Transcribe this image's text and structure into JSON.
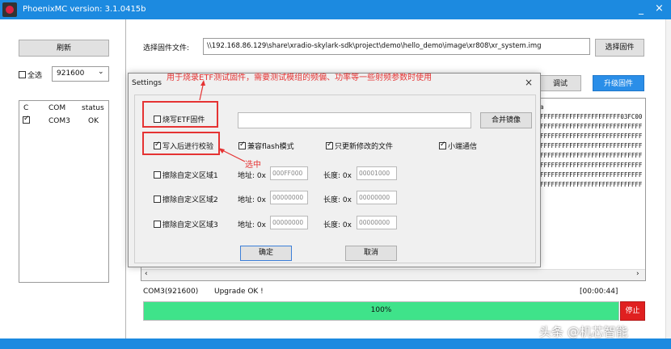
{
  "window": {
    "title": "PhoenixMC version: 3.1.0415b",
    "min_glyph": "_",
    "close_glyph": "×"
  },
  "left": {
    "refresh_label": "刷新",
    "select_all_label": "全选",
    "baud_value": "921600",
    "table_headers": [
      "C",
      "COM",
      "status"
    ],
    "rows": [
      {
        "checked": true,
        "com": "COM3",
        "status": "OK"
      }
    ]
  },
  "firmware": {
    "label": "选择固件文件:",
    "path": "\\\\192.168.86.129\\share\\xradio-skylark-sdk\\project\\demo\\hello_demo\\image\\xr808\\xr_system.img",
    "select_button": "选择固件"
  },
  "tabs": {
    "debug": "调试",
    "upgrade": "升级固件"
  },
  "hex_panel": {
    "header": "a",
    "lines": [
      "FFFFFFFFFFFFFFFFFFFFFF03FC00",
      "FFFFFFFFFFFFFFFFFFFFFFFFFFFF",
      "FFFFFFFFFFFFFFFFFFFFFFFFFFFF",
      "FFFFFFFFFFFFFFFFFFFFFFFFFFFF",
      "FFFFFFFFFFFFFFFFFFFFFFFFFFFF",
      "FFFFFFFFFFFFFFFFFFFFFFFFFFFF",
      "FFFFFFFFFFFFFFFFFFFFFFFFFFFF",
      "FFFFFFFFFFFFFFFFFFFFFFFFFFFF"
    ]
  },
  "settings": {
    "title": "Settings",
    "close_glyph": "×",
    "burn_etf_label": "烧写ETF固件",
    "merge_button": "合并镜像",
    "verify_label": "写入后进行校验",
    "flash_compat_label": "兼容flash模式",
    "only_modified_label": "只更新修改的文件",
    "little_endian_label": "小端通信",
    "erase_areas": [
      {
        "label": "擦除自定义区域1",
        "addr_label": "地址: 0x",
        "addr": "000FF000",
        "len_label": "长度: 0x",
        "len": "00001000"
      },
      {
        "label": "擦除自定义区域2",
        "addr_label": "地址: 0x",
        "addr": "00000000",
        "len_label": "长度: 0x",
        "len": "00000000"
      },
      {
        "label": "擦除自定义区域3",
        "addr_label": "地址: 0x",
        "addr": "00000000",
        "len_label": "长度: 0x",
        "len": "00000000"
      }
    ],
    "ok_button": "确定",
    "cancel_button": "取消"
  },
  "annotations": {
    "top": "用于烧录ETF测试固件，需要测试模组的频偏、功率等一些射频参数时使用",
    "selected": "选中"
  },
  "status": {
    "port": "COM3(921600)",
    "message": "Upgrade OK !",
    "time": "[00:00:44]",
    "progress_fraction": 1.0,
    "progress_text": "100%",
    "stop_button": "停止"
  },
  "watermark": "头条 @机芯智能",
  "colors": {
    "titlebar": "#1c8ae0",
    "progress": "#3fe38a",
    "accent_button": "#2a8ee8",
    "annotation": "#e53333",
    "stop": "#e02020"
  }
}
